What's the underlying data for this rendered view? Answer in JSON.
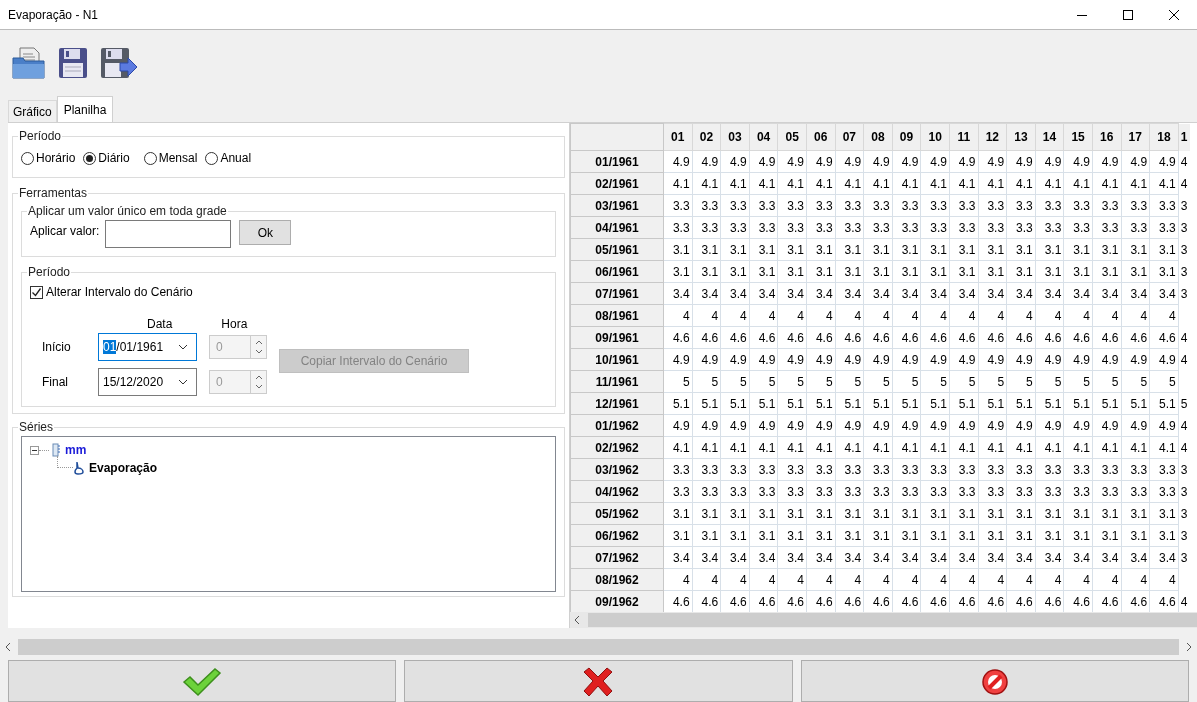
{
  "window": {
    "title": "Evaporação - N1"
  },
  "tabs": [
    {
      "label": "Gráfico",
      "selected": false
    },
    {
      "label": "Planilha",
      "selected": true
    }
  ],
  "period": {
    "legend": "Período",
    "options": [
      {
        "label": "Horário",
        "selected": false
      },
      {
        "label": "Diário",
        "selected": true
      },
      {
        "label": "Mensal",
        "selected": false
      },
      {
        "label": "Anual",
        "selected": false
      }
    ]
  },
  "tools": {
    "legend": "Ferramentas",
    "apply": {
      "legend": "Aplicar um valor único em toda grade",
      "label": "Aplicar valor:",
      "button": "Ok"
    },
    "interval": {
      "legend": "Período",
      "checkbox": {
        "label": "Alterar Intervalo do Cenário",
        "checked": true
      },
      "date_header": "Data",
      "hour_header": "Hora",
      "rows": [
        {
          "label": "Início",
          "date": "01/01/1961",
          "hour": "0",
          "focused": true,
          "hour_disabled": true
        },
        {
          "label": "Final",
          "date": "15/12/2020",
          "hour": "0",
          "focused": false,
          "hour_disabled": true
        }
      ],
      "copy_button": {
        "label": "Copiar Intervalo do Cenário",
        "disabled": true
      }
    }
  },
  "series": {
    "legend": "Séries",
    "tree": [
      {
        "label": "mm",
        "expanded": true,
        "children": [
          {
            "label": "Evaporação"
          }
        ]
      }
    ]
  },
  "grid": {
    "columns": [
      "01",
      "02",
      "03",
      "04",
      "05",
      "06",
      "07",
      "08",
      "09",
      "10",
      "11",
      "12",
      "13",
      "14",
      "15",
      "16",
      "17",
      "18"
    ],
    "column_cut": "1",
    "rows": [
      {
        "label": "01/1961",
        "cells": [
          "4.9",
          "4.9",
          "4.9",
          "4.9",
          "4.9",
          "4.9",
          "4.9",
          "4.9",
          "4.9",
          "4.9",
          "4.9",
          "4.9",
          "4.9",
          "4.9",
          "4.9",
          "4.9",
          "4.9",
          "4.9"
        ],
        "cut": "4"
      },
      {
        "label": "02/1961",
        "cells": [
          "4.1",
          "4.1",
          "4.1",
          "4.1",
          "4.1",
          "4.1",
          "4.1",
          "4.1",
          "4.1",
          "4.1",
          "4.1",
          "4.1",
          "4.1",
          "4.1",
          "4.1",
          "4.1",
          "4.1",
          "4.1"
        ],
        "cut": "4"
      },
      {
        "label": "03/1961",
        "cells": [
          "3.3",
          "3.3",
          "3.3",
          "3.3",
          "3.3",
          "3.3",
          "3.3",
          "3.3",
          "3.3",
          "3.3",
          "3.3",
          "3.3",
          "3.3",
          "3.3",
          "3.3",
          "3.3",
          "3.3",
          "3.3"
        ],
        "cut": "3"
      },
      {
        "label": "04/1961",
        "cells": [
          "3.3",
          "3.3",
          "3.3",
          "3.3",
          "3.3",
          "3.3",
          "3.3",
          "3.3",
          "3.3",
          "3.3",
          "3.3",
          "3.3",
          "3.3",
          "3.3",
          "3.3",
          "3.3",
          "3.3",
          "3.3"
        ],
        "cut": "3"
      },
      {
        "label": "05/1961",
        "cells": [
          "3.1",
          "3.1",
          "3.1",
          "3.1",
          "3.1",
          "3.1",
          "3.1",
          "3.1",
          "3.1",
          "3.1",
          "3.1",
          "3.1",
          "3.1",
          "3.1",
          "3.1",
          "3.1",
          "3.1",
          "3.1"
        ],
        "cut": "3"
      },
      {
        "label": "06/1961",
        "cells": [
          "3.1",
          "3.1",
          "3.1",
          "3.1",
          "3.1",
          "3.1",
          "3.1",
          "3.1",
          "3.1",
          "3.1",
          "3.1",
          "3.1",
          "3.1",
          "3.1",
          "3.1",
          "3.1",
          "3.1",
          "3.1"
        ],
        "cut": "3"
      },
      {
        "label": "07/1961",
        "cells": [
          "3.4",
          "3.4",
          "3.4",
          "3.4",
          "3.4",
          "3.4",
          "3.4",
          "3.4",
          "3.4",
          "3.4",
          "3.4",
          "3.4",
          "3.4",
          "3.4",
          "3.4",
          "3.4",
          "3.4",
          "3.4"
        ],
        "cut": "3"
      },
      {
        "label": "08/1961",
        "cells": [
          "4",
          "4",
          "4",
          "4",
          "4",
          "4",
          "4",
          "4",
          "4",
          "4",
          "4",
          "4",
          "4",
          "4",
          "4",
          "4",
          "4",
          "4"
        ]
      },
      {
        "label": "09/1961",
        "cells": [
          "4.6",
          "4.6",
          "4.6",
          "4.6",
          "4.6",
          "4.6",
          "4.6",
          "4.6",
          "4.6",
          "4.6",
          "4.6",
          "4.6",
          "4.6",
          "4.6",
          "4.6",
          "4.6",
          "4.6",
          "4.6"
        ],
        "cut": "4"
      },
      {
        "label": "10/1961",
        "cells": [
          "4.9",
          "4.9",
          "4.9",
          "4.9",
          "4.9",
          "4.9",
          "4.9",
          "4.9",
          "4.9",
          "4.9",
          "4.9",
          "4.9",
          "4.9",
          "4.9",
          "4.9",
          "4.9",
          "4.9",
          "4.9"
        ],
        "cut": "4"
      },
      {
        "label": "11/1961",
        "cells": [
          "5",
          "5",
          "5",
          "5",
          "5",
          "5",
          "5",
          "5",
          "5",
          "5",
          "5",
          "5",
          "5",
          "5",
          "5",
          "5",
          "5",
          "5"
        ]
      },
      {
        "label": "12/1961",
        "cells": [
          "5.1",
          "5.1",
          "5.1",
          "5.1",
          "5.1",
          "5.1",
          "5.1",
          "5.1",
          "5.1",
          "5.1",
          "5.1",
          "5.1",
          "5.1",
          "5.1",
          "5.1",
          "5.1",
          "5.1",
          "5.1"
        ],
        "cut": "5"
      },
      {
        "label": "01/1962",
        "cells": [
          "4.9",
          "4.9",
          "4.9",
          "4.9",
          "4.9",
          "4.9",
          "4.9",
          "4.9",
          "4.9",
          "4.9",
          "4.9",
          "4.9",
          "4.9",
          "4.9",
          "4.9",
          "4.9",
          "4.9",
          "4.9"
        ],
        "cut": "4"
      },
      {
        "label": "02/1962",
        "cells": [
          "4.1",
          "4.1",
          "4.1",
          "4.1",
          "4.1",
          "4.1",
          "4.1",
          "4.1",
          "4.1",
          "4.1",
          "4.1",
          "4.1",
          "4.1",
          "4.1",
          "4.1",
          "4.1",
          "4.1",
          "4.1"
        ],
        "cut": "4"
      },
      {
        "label": "03/1962",
        "cells": [
          "3.3",
          "3.3",
          "3.3",
          "3.3",
          "3.3",
          "3.3",
          "3.3",
          "3.3",
          "3.3",
          "3.3",
          "3.3",
          "3.3",
          "3.3",
          "3.3",
          "3.3",
          "3.3",
          "3.3",
          "3.3"
        ],
        "cut": "3"
      },
      {
        "label": "04/1962",
        "cells": [
          "3.3",
          "3.3",
          "3.3",
          "3.3",
          "3.3",
          "3.3",
          "3.3",
          "3.3",
          "3.3",
          "3.3",
          "3.3",
          "3.3",
          "3.3",
          "3.3",
          "3.3",
          "3.3",
          "3.3",
          "3.3"
        ],
        "cut": "3"
      },
      {
        "label": "05/1962",
        "cells": [
          "3.1",
          "3.1",
          "3.1",
          "3.1",
          "3.1",
          "3.1",
          "3.1",
          "3.1",
          "3.1",
          "3.1",
          "3.1",
          "3.1",
          "3.1",
          "3.1",
          "3.1",
          "3.1",
          "3.1",
          "3.1"
        ],
        "cut": "3"
      },
      {
        "label": "06/1962",
        "cells": [
          "3.1",
          "3.1",
          "3.1",
          "3.1",
          "3.1",
          "3.1",
          "3.1",
          "3.1",
          "3.1",
          "3.1",
          "3.1",
          "3.1",
          "3.1",
          "3.1",
          "3.1",
          "3.1",
          "3.1",
          "3.1"
        ],
        "cut": "3"
      },
      {
        "label": "07/1962",
        "cells": [
          "3.4",
          "3.4",
          "3.4",
          "3.4",
          "3.4",
          "3.4",
          "3.4",
          "3.4",
          "3.4",
          "3.4",
          "3.4",
          "3.4",
          "3.4",
          "3.4",
          "3.4",
          "3.4",
          "3.4",
          "3.4"
        ],
        "cut": "3"
      },
      {
        "label": "08/1962",
        "cells": [
          "4",
          "4",
          "4",
          "4",
          "4",
          "4",
          "4",
          "4",
          "4",
          "4",
          "4",
          "4",
          "4",
          "4",
          "4",
          "4",
          "4",
          "4"
        ]
      },
      {
        "label": "09/1962",
        "cells": [
          "4.6",
          "4.6",
          "4.6",
          "4.6",
          "4.6",
          "4.6",
          "4.6",
          "4.6",
          "4.6",
          "4.6",
          "4.6",
          "4.6",
          "4.6",
          "4.6",
          "4.6",
          "4.6",
          "4.6",
          "4.6"
        ],
        "cut": "4"
      }
    ]
  }
}
